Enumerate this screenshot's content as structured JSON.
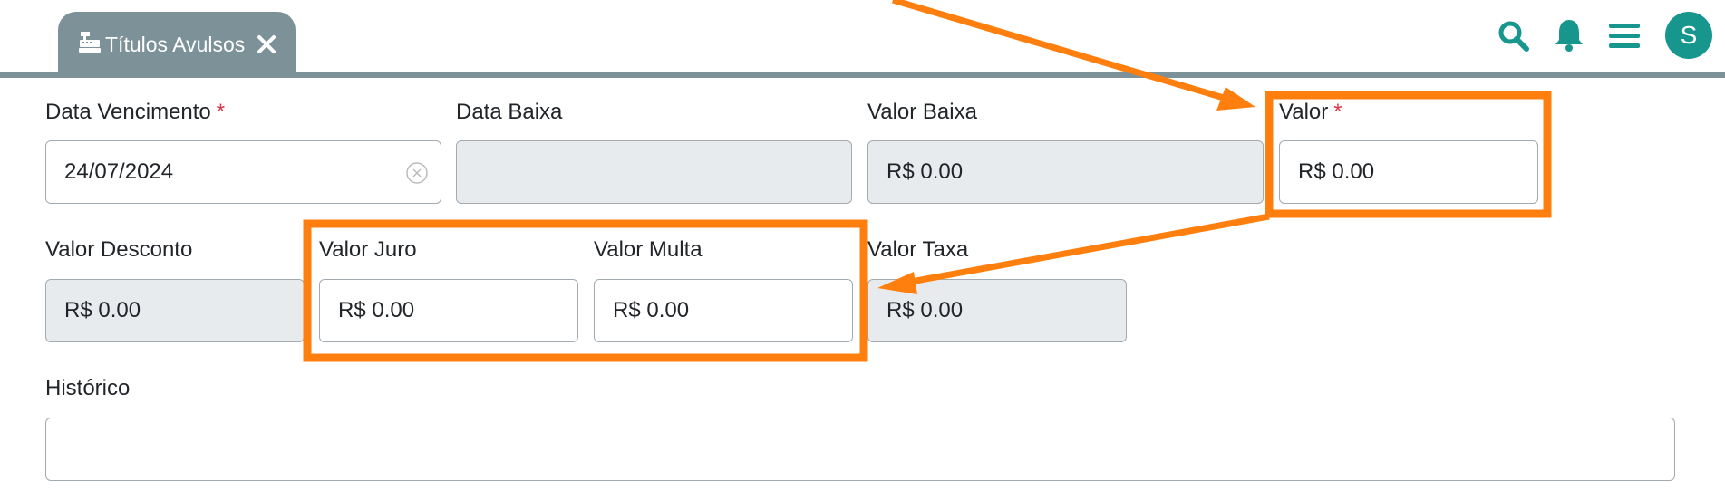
{
  "tab": {
    "title": "Títulos Avulsos",
    "icon": "cash-register-icon",
    "close_icon": "close-icon"
  },
  "header": {
    "icons": [
      "search-icon",
      "bell-icon",
      "menu-icon"
    ],
    "avatar_initial": "S",
    "accent_color": "#17968e"
  },
  "form": {
    "data_vencimento": {
      "label": "Data Vencimento",
      "required": "*",
      "value": "24/07/2024"
    },
    "data_baixa": {
      "label": "Data Baixa",
      "value": ""
    },
    "valor_baixa": {
      "label": "Valor Baixa",
      "value": "R$ 0.00"
    },
    "valor": {
      "label": "Valor",
      "required": "*",
      "value": "R$ 0.00"
    },
    "valor_desconto": {
      "label": "Valor Desconto",
      "value": "R$ 0.00"
    },
    "valor_juro": {
      "label": "Valor Juro",
      "value": "R$ 0.00"
    },
    "valor_multa": {
      "label": "Valor Multa",
      "value": "R$ 0.00"
    },
    "valor_taxa": {
      "label": "Valor Taxa",
      "value": "R$ 0.00"
    },
    "historico": {
      "label": "Histórico",
      "value": ""
    }
  },
  "annotation": {
    "color": "#ff7f0e"
  }
}
